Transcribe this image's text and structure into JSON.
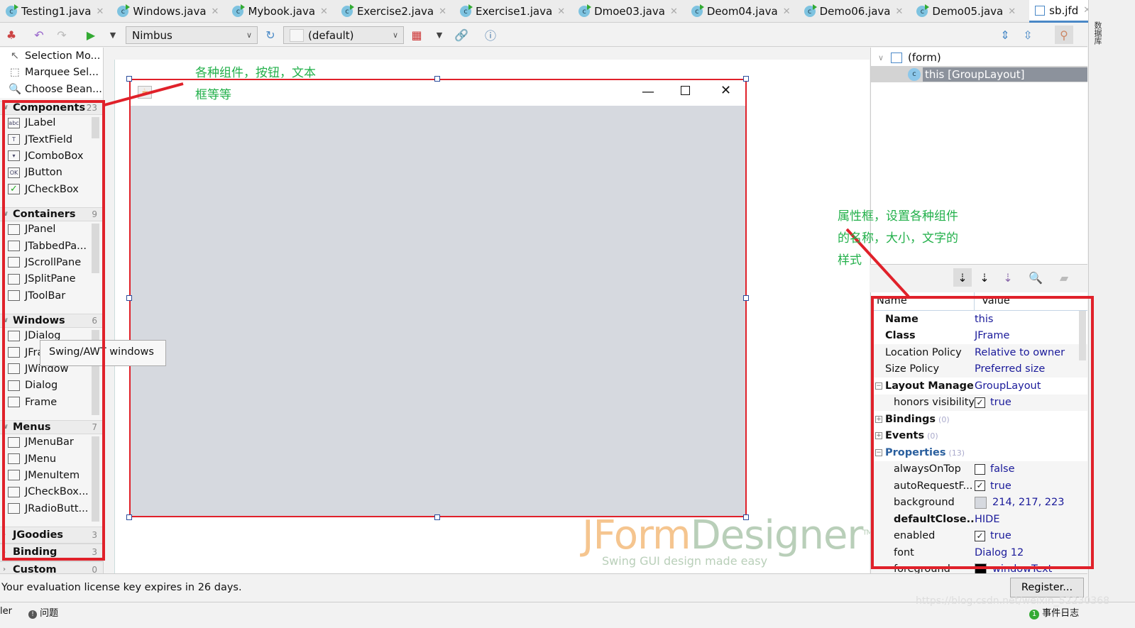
{
  "tabs": [
    {
      "label": "Testing1.java"
    },
    {
      "label": "Windows.java"
    },
    {
      "label": "Mybook.java"
    },
    {
      "label": "Exercise2.java"
    },
    {
      "label": "Exercise1.java"
    },
    {
      "label": "Dmoe03.java"
    },
    {
      "label": "Deom04.java"
    },
    {
      "label": "Demo06.java"
    },
    {
      "label": "Demo05.java"
    },
    {
      "label": "sb.jfd",
      "active": true
    }
  ],
  "toolbar": {
    "look_and_feel": "Nimbus",
    "locale": "(default)"
  },
  "palette": {
    "tools": [
      "Selection Mo...",
      "Marquee Sel...",
      "Choose Bean..."
    ],
    "sections": [
      {
        "name": "Components",
        "count": "23",
        "items": [
          "JLabel",
          "JTextField",
          "JComboBox",
          "JButton",
          "JCheckBox"
        ]
      },
      {
        "name": "Containers",
        "count": "9",
        "items": [
          "JPanel",
          "JTabbedPa...",
          "JScrollPane",
          "JSplitPane",
          "JToolBar"
        ]
      },
      {
        "name": "Windows",
        "count": "6",
        "items": [
          "JDialog",
          "JFrame",
          "JWindow",
          "Dialog",
          "Frame"
        ]
      },
      {
        "name": "Menus",
        "count": "7",
        "items": [
          "JMenuBar",
          "JMenu",
          "JMenuItem",
          "JCheckBox...",
          "JRadioButt..."
        ]
      },
      {
        "name": "JGoodies",
        "count": "3"
      },
      {
        "name": "Binding",
        "count": "3"
      },
      {
        "name": "Custom",
        "count": "0"
      }
    ],
    "tooltip": "Swing/AWT windows"
  },
  "annotations": {
    "components": "各种组件，按钮，文本框等等",
    "properties": "属性框，设置各种组件的名称，大小，文字的样式",
    "color": "#e0212a"
  },
  "logo": {
    "name": "JFormDesigner",
    "tm": "TM",
    "tagline": "Swing GUI design made easy"
  },
  "tree": {
    "root": "(form)",
    "child": "this [GroupLayout]"
  },
  "properties": {
    "header": {
      "name": "Name",
      "value": "Value"
    },
    "rows": [
      {
        "name": "Name",
        "value": "this",
        "bold": true
      },
      {
        "name": "Class",
        "value": "JFrame",
        "bold": true
      },
      {
        "name": "Location Policy",
        "value": "Relative to owner"
      },
      {
        "name": "Size Policy",
        "value": "Preferred size"
      },
      {
        "name": "Layout Manage...",
        "value": "GroupLayout",
        "bold": true,
        "toggle": "minus"
      },
      {
        "name": "honors visibility",
        "value": "true",
        "check": true,
        "sub": true
      },
      {
        "name": "Bindings",
        "count": "(0)",
        "bold": true,
        "toggle": "plus"
      },
      {
        "name": "Events",
        "count": "(0)",
        "bold": true,
        "toggle": "plus"
      },
      {
        "name": "Properties",
        "count": "(13)",
        "bold": true,
        "toggle": "minus",
        "blue": true
      },
      {
        "name": "alwaysOnTop",
        "value": "false",
        "check": false,
        "sub": true
      },
      {
        "name": "autoRequestF...",
        "value": "true",
        "check": true,
        "sub": true
      },
      {
        "name": "background",
        "value": "214, 217, 223",
        "swatch": "#d6d9df",
        "sub": true
      },
      {
        "name": "defaultClose...",
        "value": "HIDE",
        "sub": true,
        "bold": true
      },
      {
        "name": "enabled",
        "value": "true",
        "check": true,
        "sub": true
      },
      {
        "name": "font",
        "value": "Dialog 12",
        "sub": true
      },
      {
        "name": "foreground",
        "value": "windowText",
        "swatch": "#000000",
        "sub": true
      }
    ]
  },
  "right_strip": {
    "label": "数据库"
  },
  "status": {
    "message": "Your evaluation license key expires in 26 days.",
    "register": "Register..."
  },
  "bottom": {
    "left": "ler",
    "problems": "问题",
    "event_log": "事件日志",
    "event_count": "1",
    "watermark": "https://blog.csdn.net/weixin_52230368"
  }
}
